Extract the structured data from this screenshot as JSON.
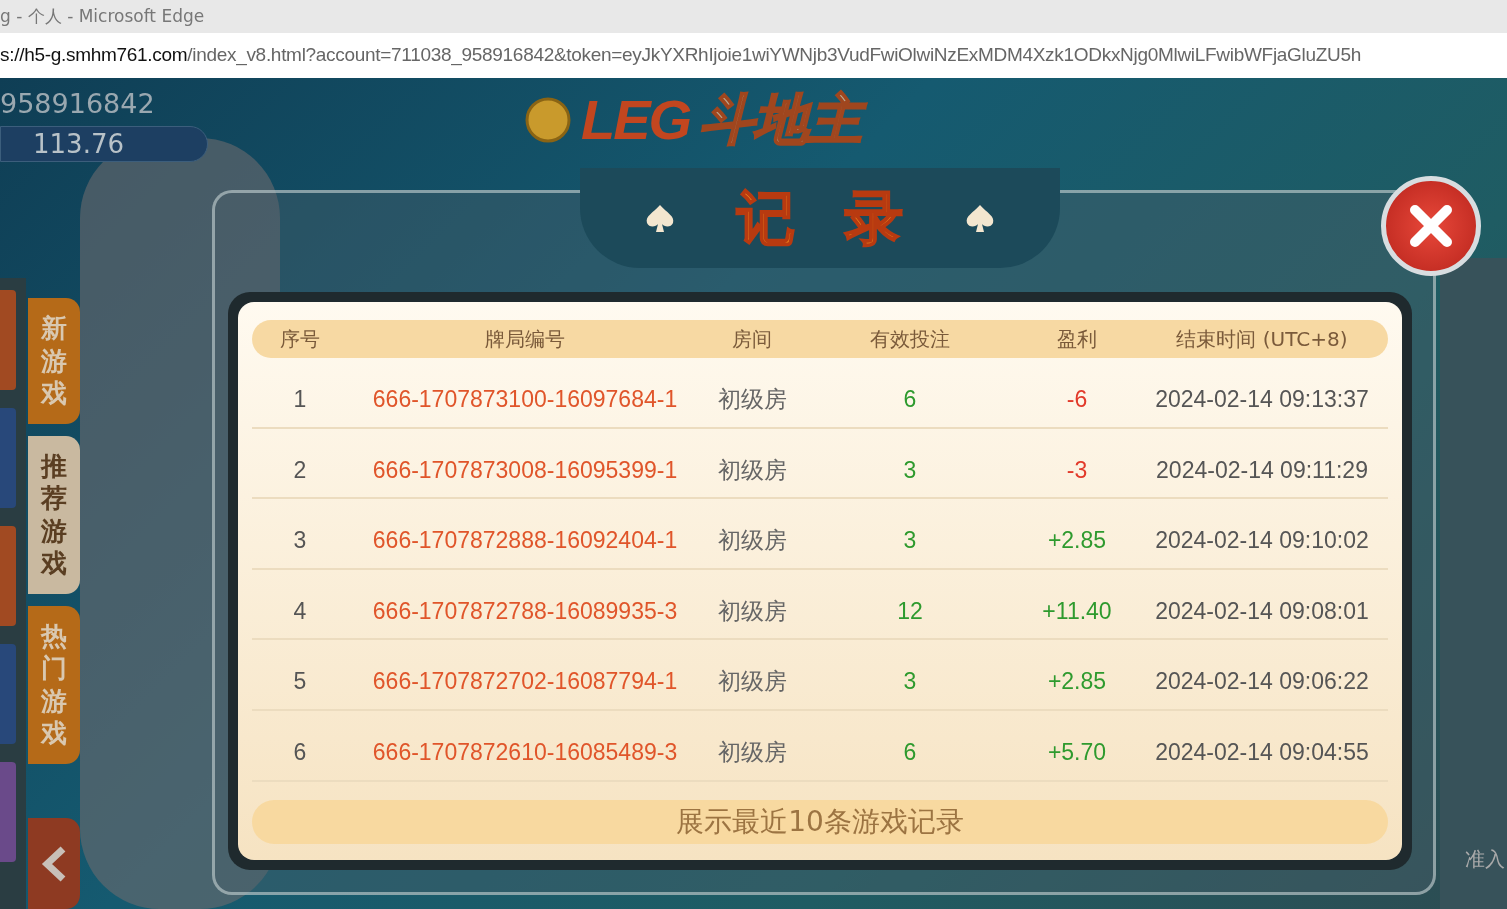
{
  "window": {
    "title": "g - 个人 - Microsoft Edge"
  },
  "address_bar": {
    "host": "s://h5-g.smhm761.com",
    "path": "/index_v8.html?account=711038_958916842&token=eyJkYXRhIjoie1wiYWNjb3VudFwiOlwiNzExMDM4Xzk1ODkxNjg0MlwiLFwibWFjaGluZU5h"
  },
  "account": {
    "id": "958916842",
    "balance": "113.76"
  },
  "logo": {
    "brand": "LEG",
    "game": "斗地主"
  },
  "side_tabs": [
    {
      "label": "新游戏",
      "selected": false
    },
    {
      "label": "推荐游戏",
      "selected": true
    },
    {
      "label": "热门游戏",
      "selected": false
    }
  ],
  "background_label": "准入",
  "dialog": {
    "title": [
      "记",
      "录"
    ],
    "columns": [
      "序号",
      "牌局编号",
      "房间",
      "有效投注",
      "盈利",
      "结束时间 (UTC+8)"
    ],
    "rows": [
      {
        "no": "1",
        "round_id": "666-1707873100-16097684-1",
        "room": "初级房",
        "bet": "6",
        "profit": "-6",
        "color": "#e23a2a",
        "end_time": "2024-02-14 09:13:37"
      },
      {
        "no": "2",
        "round_id": "666-1707873008-16095399-1",
        "room": "初级房",
        "bet": "3",
        "profit": "-3",
        "color": "#e23a2a",
        "end_time": "2024-02-14 09:11:29"
      },
      {
        "no": "3",
        "round_id": "666-1707872888-16092404-1",
        "room": "初级房",
        "bet": "3",
        "profit": "+2.85",
        "color": "#2e9a2e",
        "end_time": "2024-02-14 09:10:02"
      },
      {
        "no": "4",
        "round_id": "666-1707872788-16089935-3",
        "room": "初级房",
        "bet": "12",
        "profit": "+11.40",
        "color": "#2e9a2e",
        "end_time": "2024-02-14 09:08:01"
      },
      {
        "no": "5",
        "round_id": "666-1707872702-16087794-1",
        "room": "初级房",
        "bet": "3",
        "profit": "+2.85",
        "color": "#2e9a2e",
        "end_time": "2024-02-14 09:06:22"
      },
      {
        "no": "6",
        "round_id": "666-1707872610-16085489-3",
        "room": "初级房",
        "bet": "6",
        "profit": "+5.70",
        "color": "#2e9a2e",
        "end_time": "2024-02-14 09:04:55"
      }
    ],
    "footer": "展示最近10条游戏记录"
  }
}
